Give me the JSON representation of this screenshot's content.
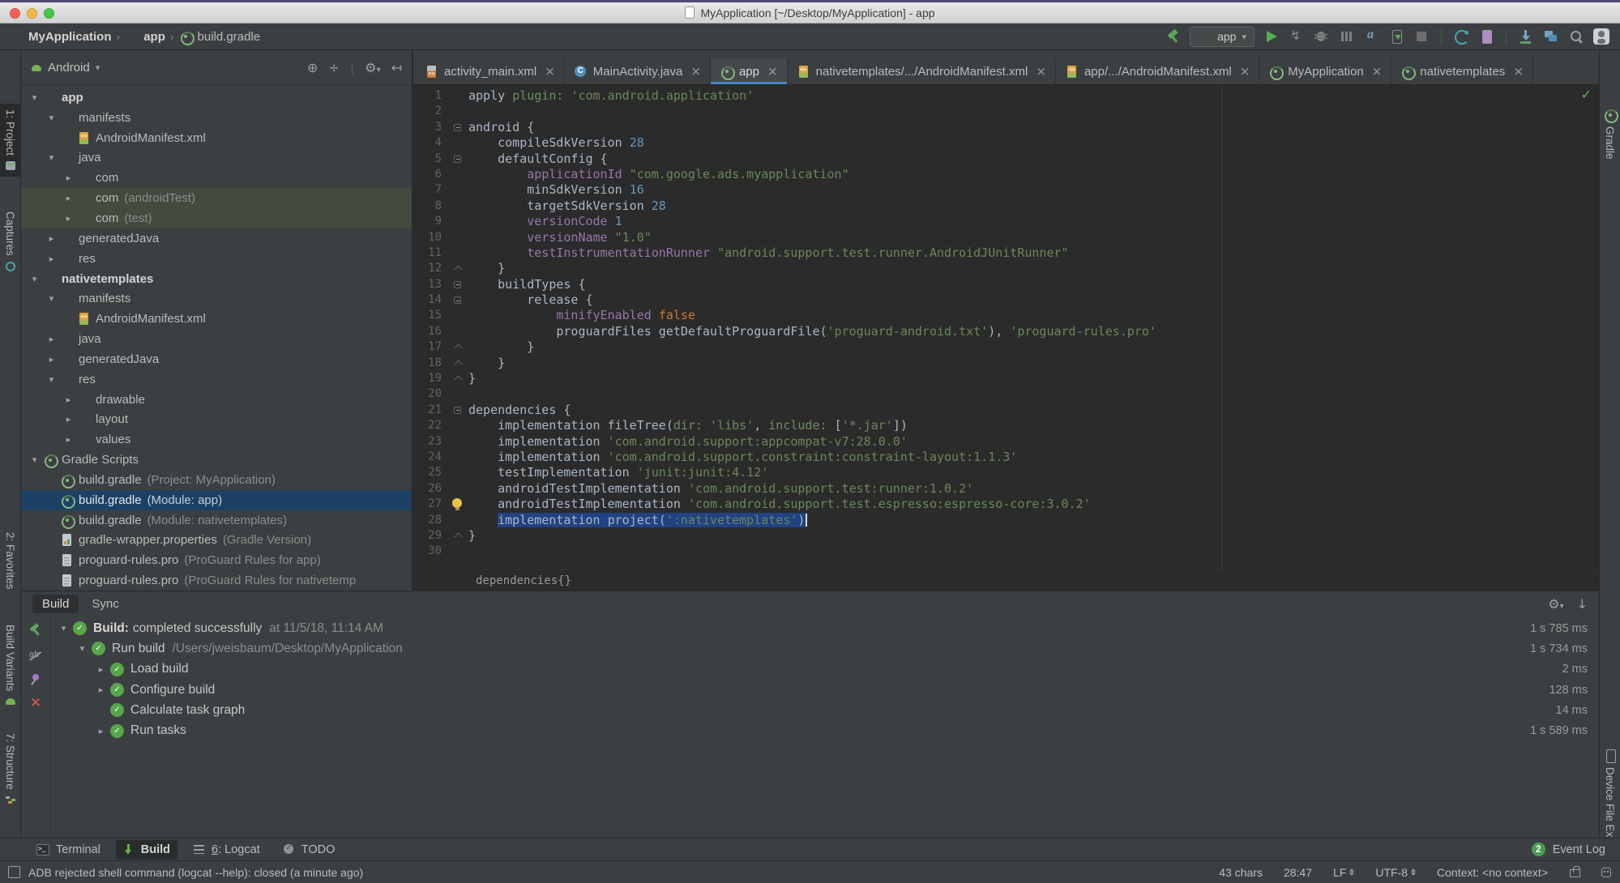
{
  "window": {
    "title": "MyApplication [~/Desktop/MyApplication] - app"
  },
  "navbar": {
    "breadcrumbs": [
      {
        "label": "MyApplication",
        "icon": "module-app",
        "bold": true
      },
      {
        "label": "app",
        "icon": "module-app",
        "bold": true
      },
      {
        "label": "build.gradle",
        "icon": "gradle",
        "bold": false
      }
    ],
    "toolbar": {
      "run_config": "app",
      "run_config_icon": "module-app",
      "items": [
        {
          "kind": "icon",
          "name": "build-hammer"
        },
        {
          "kind": "combo"
        },
        {
          "kind": "icon",
          "name": "run"
        },
        {
          "kind": "icon",
          "name": "apply-changes"
        },
        {
          "kind": "icon",
          "name": "debug"
        },
        {
          "kind": "icon",
          "name": "profile"
        },
        {
          "kind": "icon",
          "name": "attach-debugger"
        },
        {
          "kind": "icon",
          "name": "run-device"
        },
        {
          "kind": "icon",
          "name": "stop"
        },
        {
          "kind": "sep"
        },
        {
          "kind": "icon",
          "name": "gradle-sync"
        },
        {
          "kind": "icon",
          "name": "avd-manager"
        },
        {
          "kind": "sep"
        },
        {
          "kind": "icon",
          "name": "sdk-manager"
        },
        {
          "kind": "icon",
          "name": "device-file-explorer"
        },
        {
          "kind": "icon",
          "name": "search-everywhere"
        },
        {
          "kind": "icon",
          "name": "user-avatar"
        }
      ]
    }
  },
  "left_strip": [
    {
      "label": "1: Project",
      "icon": "project-view",
      "selected": true
    },
    {
      "label": "Captures",
      "icon": "captures",
      "selected": false
    },
    {
      "label": "2: Favorites",
      "icon": "star",
      "selected": false
    },
    {
      "label": "Build Variants",
      "icon": "android-head",
      "selected": false
    },
    {
      "label": "7: Structure",
      "icon": "structure",
      "selected": false
    }
  ],
  "right_strip": [
    {
      "label": "Gradle",
      "icon": "gradle"
    },
    {
      "label": "Device File Explorer",
      "icon": "phone"
    }
  ],
  "project_panel": {
    "selector": "Android",
    "header_icons": [
      "locate",
      "collapse-all",
      "settings",
      "hide"
    ],
    "tree": [
      {
        "d": 0,
        "a": "d",
        "i": "module-app",
        "l": "app",
        "b": true
      },
      {
        "d": 1,
        "a": "d",
        "i": "folder-blue",
        "l": "manifests"
      },
      {
        "d": 2,
        "a": "",
        "i": "manifest-file",
        "l": "AndroidManifest.xml"
      },
      {
        "d": 1,
        "a": "d",
        "i": "folder-blue",
        "l": "java"
      },
      {
        "d": 2,
        "a": "r",
        "i": "pkg-folder",
        "l": "com"
      },
      {
        "d": 2,
        "a": "r",
        "i": "pkg-folder",
        "l": "com",
        "ann": "(androidTest)",
        "tint": true
      },
      {
        "d": 2,
        "a": "r",
        "i": "pkg-folder",
        "l": "com",
        "ann": "(test)",
        "tint": true
      },
      {
        "d": 1,
        "a": "r",
        "i": "gen-folder",
        "l": "generatedJava"
      },
      {
        "d": 1,
        "a": "r",
        "i": "res-folder",
        "l": "res"
      },
      {
        "d": 0,
        "a": "d",
        "i": "module-chart",
        "l": "nativetemplates",
        "b": true
      },
      {
        "d": 1,
        "a": "d",
        "i": "folder-blue",
        "l": "manifests"
      },
      {
        "d": 2,
        "a": "",
        "i": "manifest-file",
        "l": "AndroidManifest.xml"
      },
      {
        "d": 1,
        "a": "r",
        "i": "folder-blue",
        "l": "java"
      },
      {
        "d": 1,
        "a": "r",
        "i": "gen-folder",
        "l": "generatedJava"
      },
      {
        "d": 1,
        "a": "d",
        "i": "res-folder",
        "l": "res"
      },
      {
        "d": 2,
        "a": "r",
        "i": "pkg-folder",
        "l": "drawable"
      },
      {
        "d": 2,
        "a": "r",
        "i": "pkg-folder",
        "l": "layout"
      },
      {
        "d": 2,
        "a": "r",
        "i": "pkg-folder",
        "l": "values"
      },
      {
        "d": 0,
        "a": "d",
        "i": "gradle",
        "l": "Gradle Scripts"
      },
      {
        "d": 1,
        "a": "",
        "i": "gradle",
        "l": "build.gradle",
        "ann": "(Project: MyApplication)"
      },
      {
        "d": 1,
        "a": "",
        "i": "gradle",
        "l": "build.gradle",
        "ann": "(Module: app)",
        "sel": true
      },
      {
        "d": 1,
        "a": "",
        "i": "gradle",
        "l": "build.gradle",
        "ann": "(Module: nativetemplates)"
      },
      {
        "d": 1,
        "a": "",
        "i": "props-file",
        "l": "gradle-wrapper.properties",
        "ann": "(Gradle Version)"
      },
      {
        "d": 1,
        "a": "",
        "i": "pro-file",
        "l": "proguard-rules.pro",
        "ann": "(ProGuard Rules for app)"
      },
      {
        "d": 1,
        "a": "",
        "i": "pro-file",
        "l": "proguard-rules.pro",
        "ann": "(ProGuard Rules for nativetemp"
      }
    ]
  },
  "editor": {
    "tabs": [
      {
        "i": "xml-file",
        "l": "activity_main.xml",
        "active": false
      },
      {
        "i": "java-class",
        "l": "MainActivity.java",
        "active": false
      },
      {
        "i": "gradle",
        "l": "app",
        "active": true
      },
      {
        "i": "manifest-file",
        "l": "nativetemplates/.../AndroidManifest.xml",
        "active": false
      },
      {
        "i": "manifest-file",
        "l": "app/.../AndroidManifest.xml",
        "active": false
      },
      {
        "i": "gradle",
        "l": "MyApplication",
        "active": false
      },
      {
        "i": "gradle",
        "l": "nativetemplates",
        "active": false
      }
    ],
    "inspection_ok": "✓",
    "breadcrumb": "dependencies{}",
    "lines": [
      {
        "t": [
          [
            "apply ",
            "d"
          ],
          [
            "plugin: ",
            "g"
          ],
          [
            "'com.android.application'",
            "s"
          ]
        ]
      },
      {
        "t": []
      },
      {
        "t": [
          [
            "android {",
            "d"
          ]
        ],
        "fold": "s"
      },
      {
        "t": [
          [
            "    compileSdkVersion ",
            "d"
          ],
          [
            "28",
            "n"
          ]
        ]
      },
      {
        "t": [
          [
            "    defaultConfig {",
            "d"
          ]
        ],
        "fold": "s"
      },
      {
        "t": [
          [
            "        ",
            "d"
          ],
          [
            "applicationId ",
            "p"
          ],
          [
            "\"com.google.ads.myapplication\"",
            "s"
          ]
        ]
      },
      {
        "t": [
          [
            "        minSdkVersion ",
            "d"
          ],
          [
            "16",
            "n"
          ]
        ]
      },
      {
        "t": [
          [
            "        targetSdkVersion ",
            "d"
          ],
          [
            "28",
            "n"
          ]
        ]
      },
      {
        "t": [
          [
            "        ",
            "d"
          ],
          [
            "versionCode ",
            "p"
          ],
          [
            "1",
            "n"
          ]
        ]
      },
      {
        "t": [
          [
            "        ",
            "d"
          ],
          [
            "versionName ",
            "p"
          ],
          [
            "\"1.0\"",
            "s"
          ]
        ]
      },
      {
        "t": [
          [
            "        ",
            "d"
          ],
          [
            "testInstrumentationRunner ",
            "p"
          ],
          [
            "\"android.support.test.runner.AndroidJUnitRunner\"",
            "s"
          ]
        ]
      },
      {
        "t": [
          [
            "    }",
            "d"
          ]
        ],
        "fold": "e"
      },
      {
        "t": [
          [
            "    buildTypes {",
            "d"
          ]
        ],
        "fold": "s"
      },
      {
        "t": [
          [
            "        release {",
            "d"
          ]
        ],
        "fold": "s"
      },
      {
        "t": [
          [
            "            ",
            "d"
          ],
          [
            "minifyEnabled ",
            "p"
          ],
          [
            "false",
            "k"
          ]
        ]
      },
      {
        "t": [
          [
            "            proguardFiles getDefaultProguardFile(",
            "d"
          ],
          [
            "'proguard-android.txt'",
            "s"
          ],
          [
            "), ",
            "d"
          ],
          [
            "'proguard-rules.pro'",
            "s"
          ]
        ]
      },
      {
        "t": [
          [
            "        }",
            "d"
          ]
        ],
        "fold": "e"
      },
      {
        "t": [
          [
            "    }",
            "d"
          ]
        ],
        "fold": "e"
      },
      {
        "t": [
          [
            "}",
            "d"
          ]
        ],
        "fold": "e"
      },
      {
        "t": []
      },
      {
        "t": [
          [
            "dependencies {",
            "d"
          ]
        ],
        "fold": "s"
      },
      {
        "t": [
          [
            "    implementation fileTree(",
            "d"
          ],
          [
            "dir: ",
            "g"
          ],
          [
            "'libs'",
            "s"
          ],
          [
            ", ",
            "d"
          ],
          [
            "include: ",
            "g"
          ],
          [
            "[",
            "d"
          ],
          [
            "'*.jar'",
            "s"
          ],
          [
            "])",
            "d"
          ]
        ]
      },
      {
        "t": [
          [
            "    implementation ",
            "d"
          ],
          [
            "'com.android.support:appcompat-v7:28.0.0'",
            "s"
          ]
        ]
      },
      {
        "t": [
          [
            "    implementation ",
            "d"
          ],
          [
            "'com.android.support.constraint:constraint-layout:1.1.3'",
            "s"
          ]
        ]
      },
      {
        "t": [
          [
            "    testImplementation ",
            "d"
          ],
          [
            "'junit:junit:4.12'",
            "s"
          ]
        ]
      },
      {
        "t": [
          [
            "    androidTestImplementation ",
            "d"
          ],
          [
            "'com.android.support.test:runner:1.0.2'",
            "s"
          ]
        ]
      },
      {
        "t": [
          [
            "    androidTestImplementation ",
            "d"
          ],
          [
            "'com.android.support.test.espresso:espresso-core:3.0.2'",
            "s"
          ]
        ],
        "bulb": true
      },
      {
        "t": [
          [
            "    ",
            "d"
          ],
          [
            "implementation project(",
            "d"
          ],
          [
            "':nativetemplates'",
            "s"
          ],
          [
            ")",
            "d"
          ]
        ],
        "selFrom": 1,
        "caret": true
      },
      {
        "t": [
          [
            "}",
            "d"
          ]
        ],
        "fold": "e"
      },
      {
        "t": []
      }
    ]
  },
  "build_panel": {
    "tabs": [
      {
        "label": "Build",
        "active": true
      },
      {
        "label": "Sync",
        "active": false
      }
    ],
    "tool_icons": [
      "build-hammer",
      "filter",
      "pin",
      "close"
    ],
    "rows": [
      {
        "d": 0,
        "a": "d",
        "bold": "Build:",
        "l": "completed successfully",
        "detail": "at 11/5/18, 11:14 AM",
        "time": "1 s 785 ms"
      },
      {
        "d": 1,
        "a": "d",
        "l": "Run build",
        "detail": "/Users/jweisbaum/Desktop/MyApplication",
        "time": "1 s 734 ms"
      },
      {
        "d": 2,
        "a": "r",
        "l": "Load build",
        "time": "2 ms"
      },
      {
        "d": 2,
        "a": "r",
        "l": "Configure build",
        "time": "128 ms"
      },
      {
        "d": 2,
        "a": "",
        "l": "Calculate task graph",
        "time": "14 ms"
      },
      {
        "d": 2,
        "a": "r",
        "l": "Run tasks",
        "time": "1 s 589 ms"
      }
    ]
  },
  "bottom_bar": {
    "items": [
      {
        "label": "Terminal",
        "icon": "terminal",
        "active": false,
        "mnemonic": false
      },
      {
        "label": "Build",
        "icon": "build-dl",
        "active": true,
        "mnemonic": false
      },
      {
        "label": "6: Logcat",
        "icon": "logcat",
        "active": false,
        "mnemonic": true
      },
      {
        "label": "TODO",
        "icon": "todo",
        "active": false,
        "mnemonic": false
      }
    ],
    "event_log": {
      "badge": "2",
      "label": "Event Log"
    }
  },
  "status_bar": {
    "message": "ADB rejected shell command (logcat --help): closed (a minute ago)",
    "chars": "43 chars",
    "caret": "28:47",
    "line_sep": "LF",
    "encoding": "UTF-8",
    "context": "Context: <no context>"
  },
  "colors": {
    "accent_blue": "#4a88c7",
    "selection_blue": "#214283",
    "tree_selection": "#1d4165",
    "string_green": "#6a8759",
    "number_blue": "#6897bb",
    "keyword_orange": "#cc7832",
    "member_purple": "#9876aa",
    "ok_green": "#57a64a",
    "panel_bg": "#3c3f41",
    "editor_bg": "#2b2b2b"
  }
}
